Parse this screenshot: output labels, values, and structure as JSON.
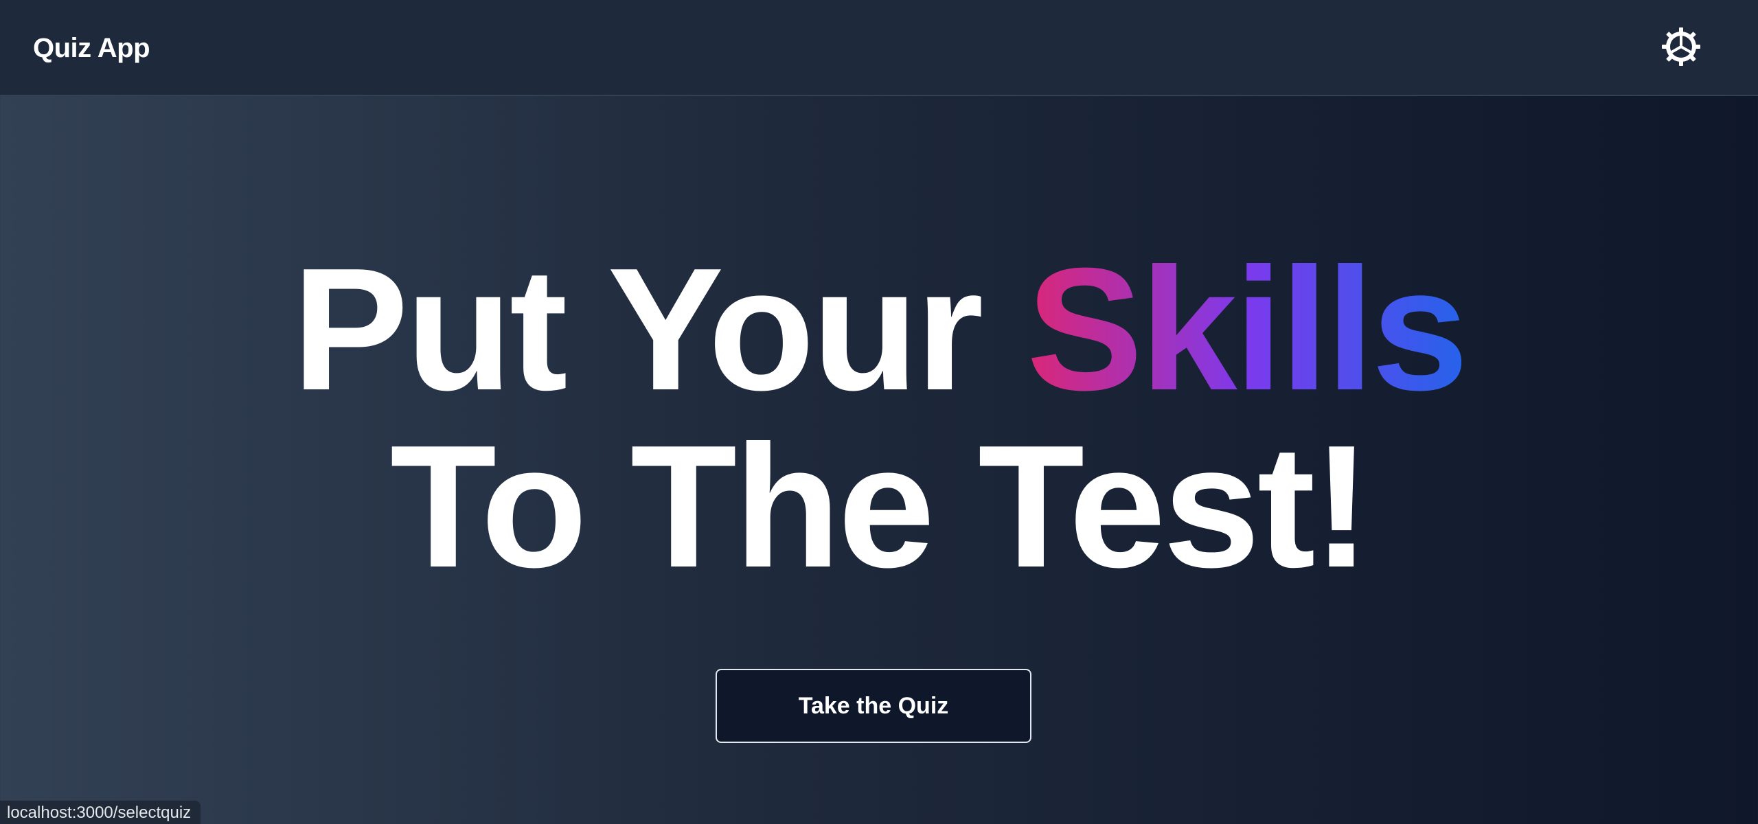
{
  "navbar": {
    "brand": "Quiz App",
    "settings_icon": "gear-icon"
  },
  "hero": {
    "line1_prefix": "Put Your ",
    "line1_highlight": "Skills",
    "line2": "To The Test!",
    "highlight_gradient": [
      "#db2777",
      "#7c3aed",
      "#2563eb"
    ]
  },
  "cta": {
    "label": "Take the Quiz"
  },
  "status_bar": {
    "url": "localhost:3000/selectquiz"
  },
  "colors": {
    "navbar_bg": "#1e293b",
    "page_gradient": [
      "#334155",
      "#1e293b",
      "#0f172a"
    ],
    "button_bg": "#0f172a",
    "text": "#ffffff"
  }
}
